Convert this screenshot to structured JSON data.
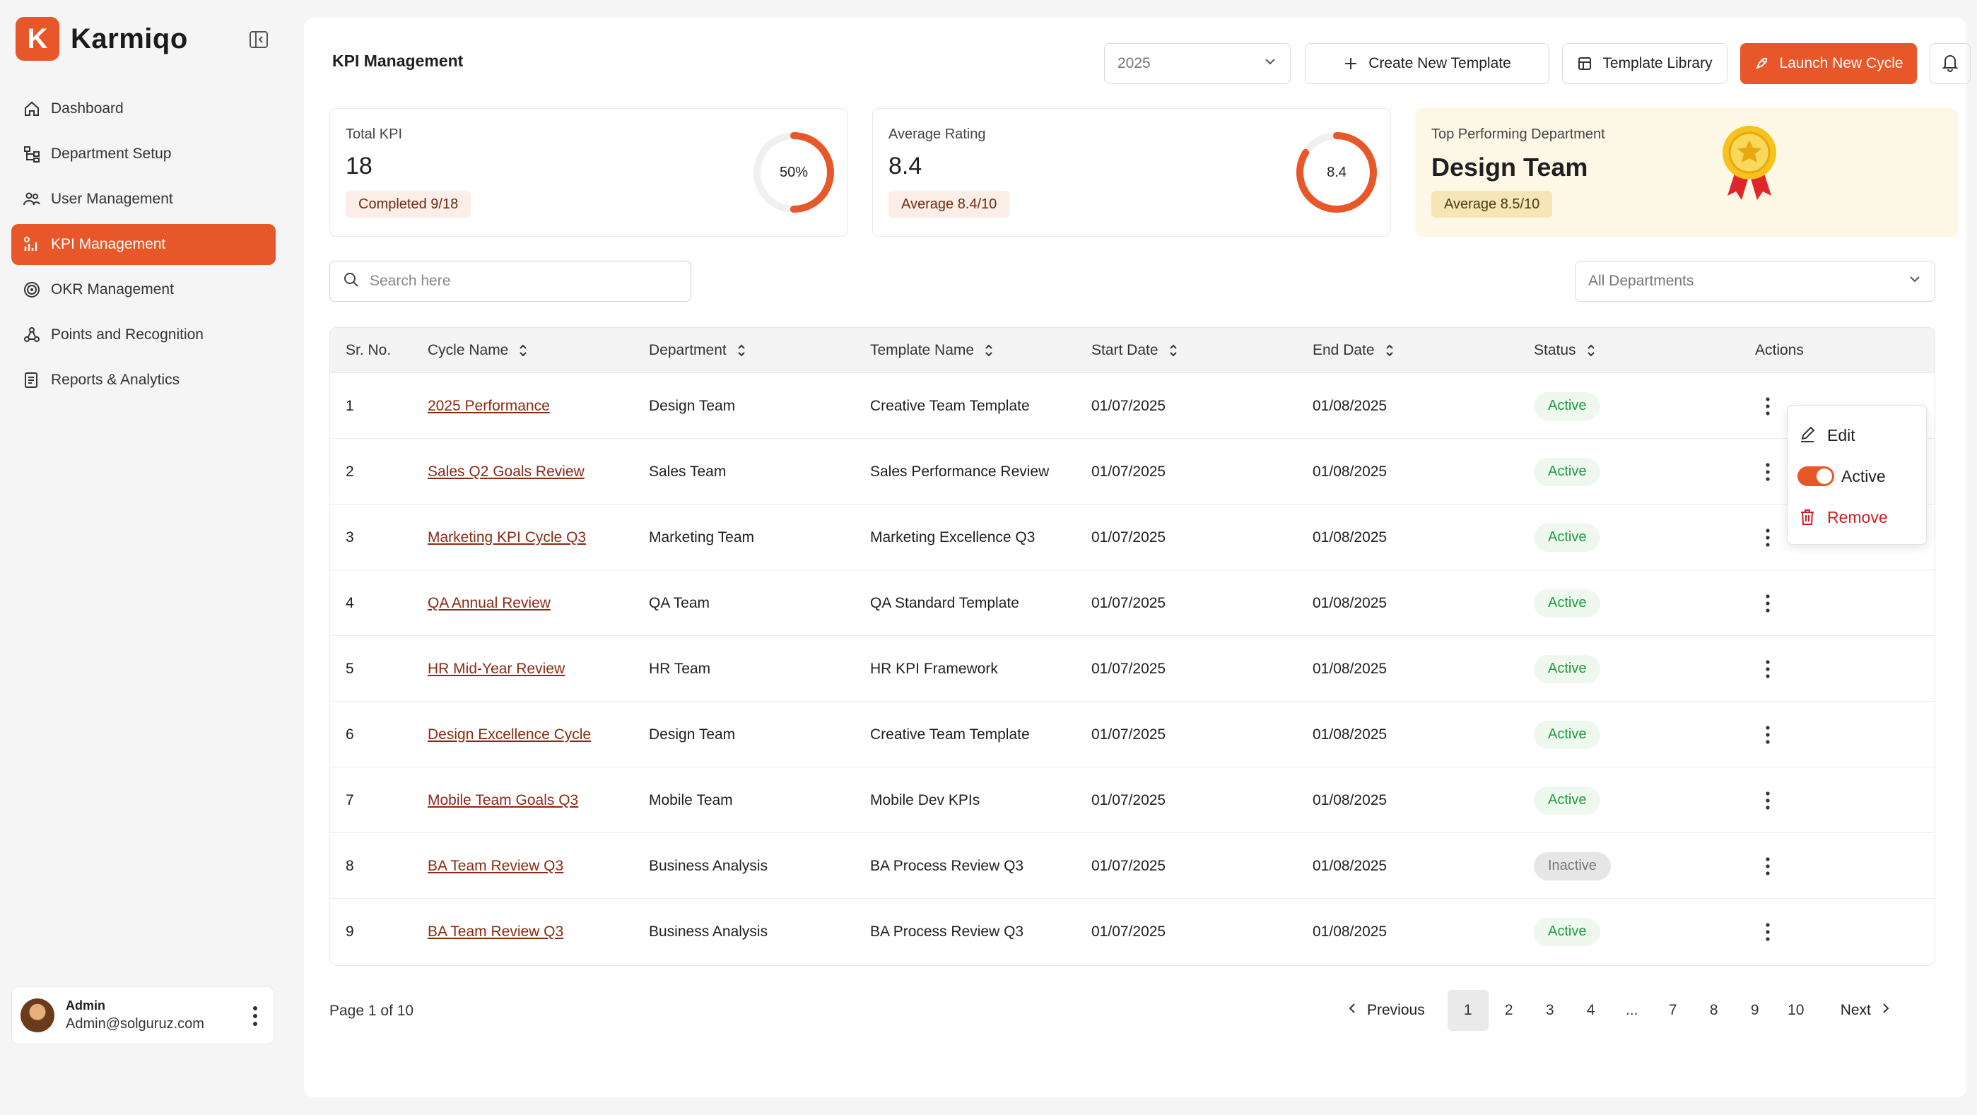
{
  "brand": {
    "initial": "K",
    "name": "Karmiqo"
  },
  "sidebar": {
    "items": [
      {
        "label": "Dashboard",
        "icon": "home-icon",
        "active": false
      },
      {
        "label": "Department Setup",
        "icon": "hierarchy-icon",
        "active": false
      },
      {
        "label": "User Management",
        "icon": "users-icon",
        "active": false
      },
      {
        "label": "KPI Management",
        "icon": "kpi-icon",
        "active": true
      },
      {
        "label": "OKR Management",
        "icon": "target-icon",
        "active": false
      },
      {
        "label": "Points and Recognition",
        "icon": "award-icon",
        "active": false
      },
      {
        "label": "Reports & Analytics",
        "icon": "report-icon",
        "active": false
      }
    ],
    "user": {
      "role": "Admin",
      "email": "Admin@solguruz.com"
    }
  },
  "header": {
    "title": "KPI Management",
    "year": "2025",
    "create_label": "Create New Template",
    "library_label": "Template Library",
    "launch_label": "Launch New Cycle"
  },
  "cards": {
    "total": {
      "label": "Total KPI",
      "value": "18",
      "chip": "Completed 9/18",
      "ring_text": "50%",
      "ring_fraction": 0.5
    },
    "rating": {
      "label": "Average Rating",
      "value": "8.4",
      "chip": "Average 8.4/10",
      "ring_text": "8.4",
      "ring_fraction": 0.84
    },
    "top": {
      "label": "Top Performing Department",
      "value": "Design Team",
      "chip": "Average 8.5/10"
    }
  },
  "filters": {
    "search_placeholder": "Search here",
    "department": "All Departments"
  },
  "table": {
    "headers": [
      "Sr. No.",
      "Cycle Name",
      "Department",
      "Template Name",
      "Start Date",
      "End Date",
      "Status",
      "Actions"
    ],
    "rows": [
      {
        "sr": "1",
        "cycle": "2025 Performance",
        "dept": "Design Team",
        "template": "Creative Team Template",
        "start": "01/07/2025",
        "end": "01/08/2025",
        "status": "Active"
      },
      {
        "sr": "2",
        "cycle": "Sales Q2 Goals Review",
        "dept": "Sales Team",
        "template": "Sales Performance Review",
        "start": "01/07/2025",
        "end": "01/08/2025",
        "status": "Active"
      },
      {
        "sr": "3",
        "cycle": "Marketing KPI Cycle Q3",
        "dept": "Marketing Team",
        "template": "Marketing Excellence Q3",
        "start": "01/07/2025",
        "end": "01/08/2025",
        "status": "Active"
      },
      {
        "sr": "4",
        "cycle": "QA Annual Review",
        "dept": "QA Team",
        "template": "QA Standard Template",
        "start": "01/07/2025",
        "end": "01/08/2025",
        "status": "Active"
      },
      {
        "sr": "5",
        "cycle": "HR Mid-Year Review",
        "dept": "HR Team",
        "template": "HR KPI Framework",
        "start": "01/07/2025",
        "end": "01/08/2025",
        "status": "Active"
      },
      {
        "sr": "6",
        "cycle": "Design Excellence Cycle",
        "dept": "Design Team",
        "template": "Creative Team Template",
        "start": "01/07/2025",
        "end": "01/08/2025",
        "status": "Active"
      },
      {
        "sr": "7",
        "cycle": "Mobile Team Goals Q3",
        "dept": "Mobile Team",
        "template": "Mobile Dev KPIs",
        "start": "01/07/2025",
        "end": "01/08/2025",
        "status": "Active"
      },
      {
        "sr": "8",
        "cycle": "BA Team Review Q3",
        "dept": "Business Analysis",
        "template": "BA Process Review Q3",
        "start": "01/07/2025",
        "end": "01/08/2025",
        "status": "Inactive"
      },
      {
        "sr": "9",
        "cycle": "BA Team Review Q3",
        "dept": "Business Analysis",
        "template": "BA Process Review Q3",
        "start": "01/07/2025",
        "end": "01/08/2025",
        "status": "Active"
      }
    ]
  },
  "row_menu": {
    "edit": "Edit",
    "active": "Active",
    "remove": "Remove"
  },
  "pagination": {
    "info": "Page 1 of 10",
    "previous": "Previous",
    "next": "Next",
    "pages": [
      "1",
      "2",
      "3",
      "4",
      "...",
      "7",
      "8",
      "9",
      "10"
    ],
    "current": "1"
  },
  "colors": {
    "accent": "#e8572a",
    "active_text": "#1f9a3f",
    "remove": "#d11f1f",
    "top_card_bg": "#fdf8e6"
  }
}
